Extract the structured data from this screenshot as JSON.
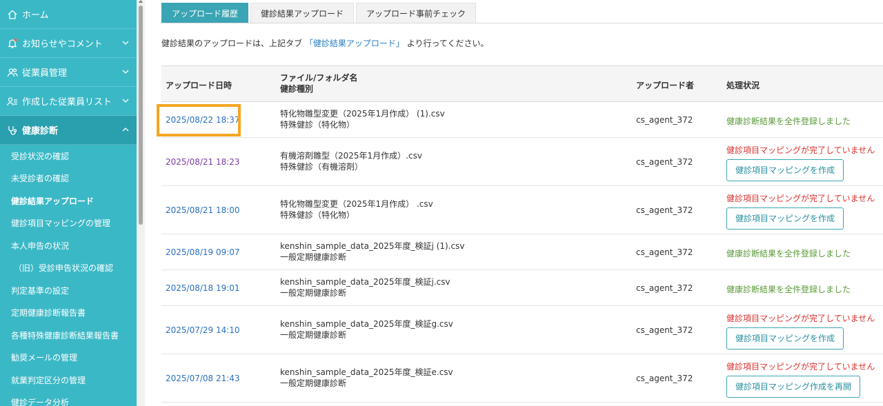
{
  "sidebar": {
    "nav": [
      {
        "label": "ホーム",
        "icon": "home-icon",
        "has_chevron": false
      },
      {
        "label": "お知らせやコメント",
        "icon": "bell-icon",
        "has_chevron": true
      },
      {
        "label": "従業員管理",
        "icon": "users-icon",
        "has_chevron": true
      },
      {
        "label": "作成した従業員リスト",
        "icon": "user-list-icon",
        "has_chevron": true
      },
      {
        "label": "健康診断",
        "icon": "stethoscope-icon",
        "has_chevron": true,
        "active": true
      }
    ],
    "sub_items": [
      {
        "label": "受診状況の確認"
      },
      {
        "label": "未受診者の確認"
      },
      {
        "label": "健診結果アップロード",
        "current": true
      },
      {
        "label": "健診項目マッピングの管理"
      },
      {
        "label": "本人申告の状況"
      },
      {
        "label": "（旧）受診申告状況の確認",
        "indent": true
      },
      {
        "label": "判定基準の設定"
      },
      {
        "label": "定期健康診断報告書"
      },
      {
        "label": "各種特殊健康診断結果報告書"
      },
      {
        "label": "勧奨メールの管理"
      },
      {
        "label": "就業判定区分の管理"
      },
      {
        "label": "健診データ分析"
      }
    ]
  },
  "tabs": [
    {
      "label": "アップロード履歴",
      "active": true
    },
    {
      "label": "健診結果アップロード"
    },
    {
      "label": "アップロード事前チェック"
    }
  ],
  "notice": {
    "before": "健診結果のアップロードは、上記タブ",
    "link": "「健診結果アップロード」",
    "after": "より行ってください。"
  },
  "table": {
    "headers": {
      "date": "アップロード日時",
      "file_line1": "ファイル/フォルダ名",
      "file_line2": "健診種別",
      "user": "アップロード者",
      "status": "処理状況"
    },
    "rows": [
      {
        "date": "2025/08/22 18:37",
        "file": "特化物雛型変更（2025年1月作成） (1).csv",
        "type": "特殊健診（特化物）",
        "user": "cs_agent_372",
        "status": "健康診断結果を全件登録しました",
        "ok": true,
        "highlighted": true
      },
      {
        "date": "2025/08/21 18:23",
        "file": "有機溶剤雛型（2025年1月作成）.csv",
        "type": "特殊健診（有機溶剤）",
        "user": "cs_agent_372",
        "status": "健診項目マッピングが完了していません",
        "ok": false,
        "button": "健診項目マッピングを作成",
        "visited": true
      },
      {
        "date": "2025/08/21 18:00",
        "file": "特化物雛型変更（2025年1月作成） .csv",
        "type": "特殊健診（特化物）",
        "user": "cs_agent_372",
        "status": "健診項目マッピングが完了していません",
        "ok": false,
        "button": "健診項目マッピングを作成"
      },
      {
        "date": "2025/08/19 09:07",
        "file": "kenshin_sample_data_2025年度_検証j (1).csv",
        "type": "一般定期健康診断",
        "user": "cs_agent_372",
        "status": "健康診断結果を全件登録しました",
        "ok": true
      },
      {
        "date": "2025/08/18 19:01",
        "file": "kenshin_sample_data_2025年度_検証j.csv",
        "type": "一般定期健康診断",
        "user": "cs_agent_372",
        "status": "健康診断結果を全件登録しました",
        "ok": true
      },
      {
        "date": "2025/07/29 14:10",
        "file": "kenshin_sample_data_2025年度_検証g.csv",
        "type": "一般定期健康診断",
        "user": "cs_agent_372",
        "status": "健診項目マッピングが完了していません",
        "ok": false,
        "button": "健診項目マッピングを作成"
      },
      {
        "date": "2025/07/08 21:43",
        "file": "kenshin_sample_data_2025年度_検証e.csv",
        "type": "一般定期健康診断",
        "user": "cs_agent_372",
        "status": "健診項目マッピングが完了していません",
        "ok": false,
        "button": "健診項目マッピング作成を再開"
      }
    ]
  },
  "colors": {
    "sidebar": "#3bb8c6",
    "sidebar_active": "#2a9fad",
    "tab_active": "#3aa5b4",
    "link": "#2a6fbf",
    "visited_link": "#7a3aa5",
    "ok": "#5b9a3a",
    "error": "#d9322e",
    "highlight": "#f5a623"
  }
}
